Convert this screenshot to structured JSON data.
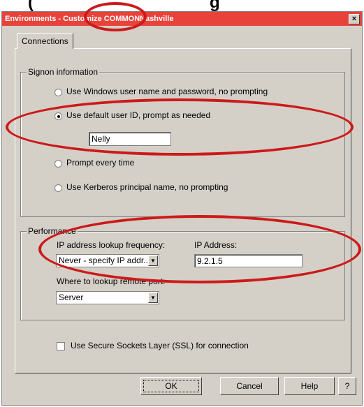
{
  "window": {
    "title_prefix": "Environments - ",
    "title_highlight": "Customize",
    "title_suffix": " COMMONNashville",
    "close_glyph": "×"
  },
  "tabs": [
    {
      "label": "Connections"
    }
  ],
  "signon": {
    "legend": "Signon information",
    "options": [
      {
        "label": "Use Windows user name and password, no prompting",
        "selected": false
      },
      {
        "label": "Use default user ID, prompt as needed",
        "selected": true
      },
      {
        "label": "Prompt every time",
        "selected": false
      },
      {
        "label": "Use Kerberos principal name, no prompting",
        "selected": false
      }
    ],
    "default_user_id": "Nelly"
  },
  "performance": {
    "legend": "Performance",
    "lookup_freq_label": "IP address lookup frequency:",
    "lookup_freq_value": "Never - specify IP addr...",
    "ip_label": "IP Address:",
    "ip_value": "9.2.1.5",
    "remote_port_label": "Where to lookup remote port:",
    "remote_port_value": "Server"
  },
  "ssl": {
    "label": "Use Secure Sockets Layer (SSL) for connection",
    "checked": false
  },
  "buttons": {
    "ok": "OK",
    "cancel": "Cancel",
    "help": "Help",
    "whats_this": "?"
  },
  "colors": {
    "titlebar": "#e8433a",
    "annotation": "#cc1a1a",
    "dialog": "#d4d0c8"
  }
}
